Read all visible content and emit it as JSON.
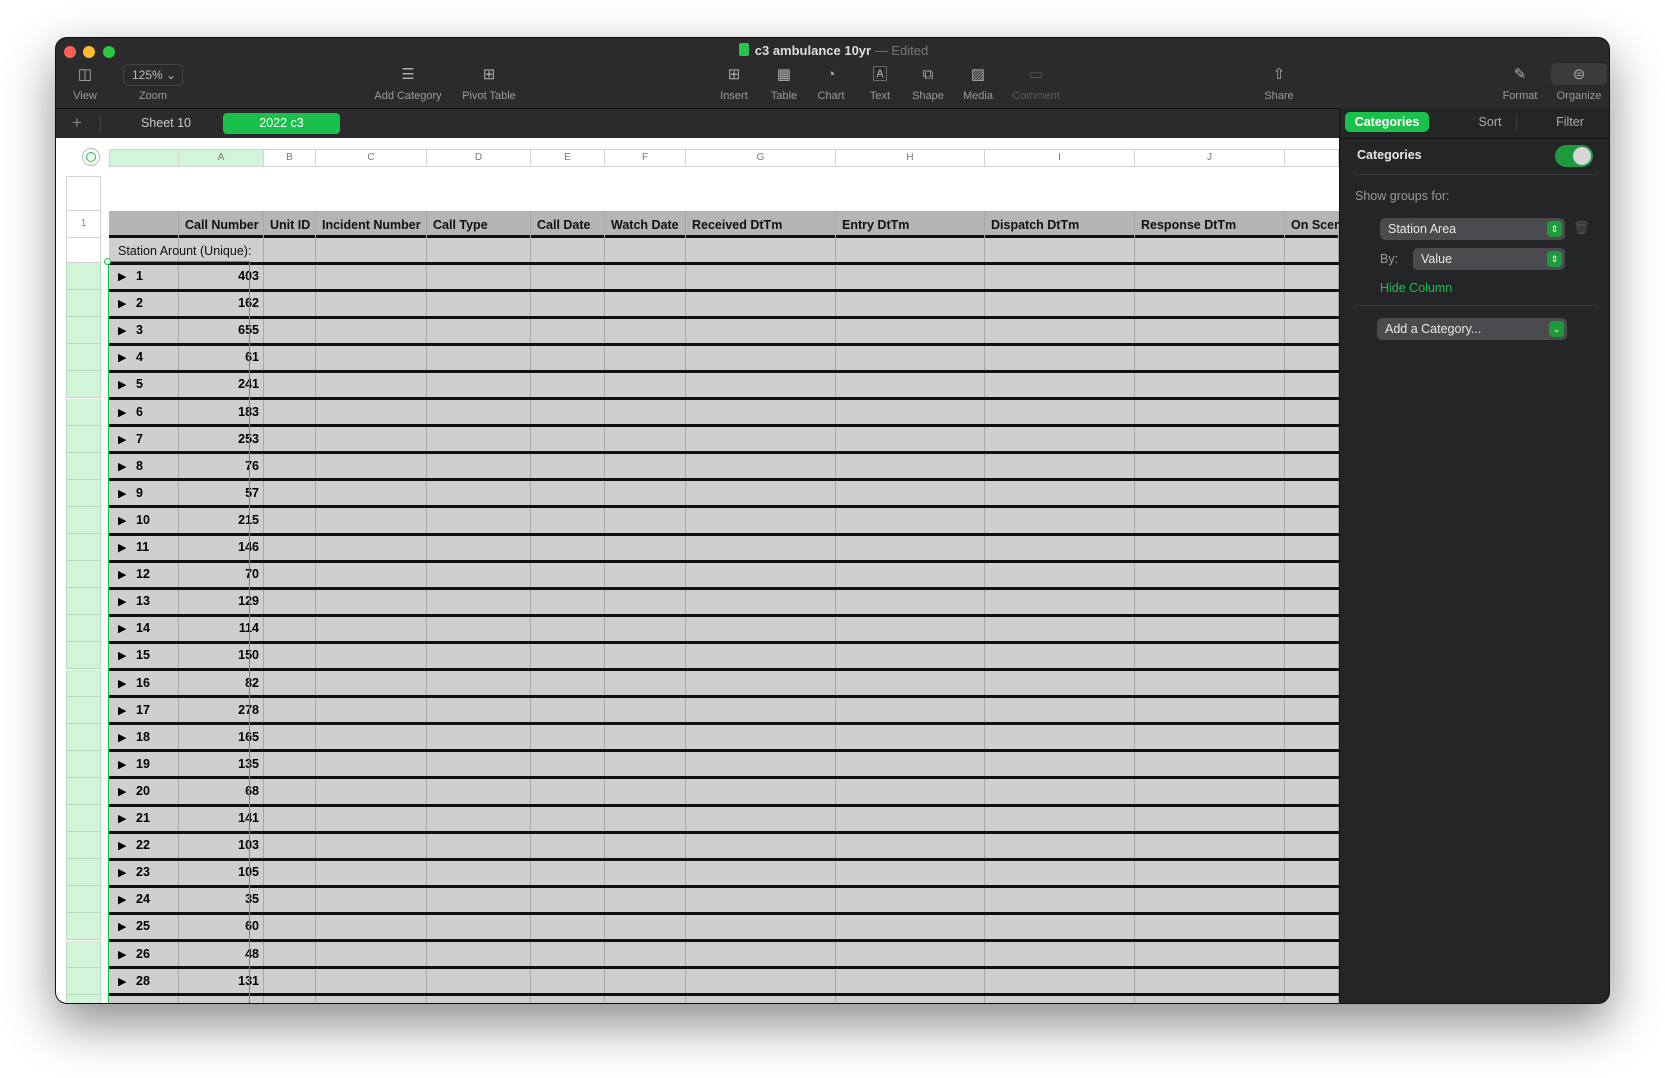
{
  "window": {
    "title": "c3 ambulance 10yr",
    "status": "Edited",
    "separator": "—"
  },
  "toolbar": {
    "view": "View",
    "zoom_label": "Zoom",
    "zoom_value": "125%",
    "add_category": "Add Category",
    "pivot_table": "Pivot Table",
    "insert": "Insert",
    "table": "Table",
    "chart": "Chart",
    "text": "Text",
    "shape": "Shape",
    "media": "Media",
    "comment": "Comment",
    "share": "Share",
    "format": "Format",
    "organize": "Organize"
  },
  "sheets": {
    "add": "+",
    "tabs": [
      "Sheet 10",
      "2022 c3"
    ],
    "active": 1
  },
  "columns": [
    "A",
    "B",
    "C",
    "D",
    "E",
    "F",
    "G",
    "H",
    "I",
    "J",
    ""
  ],
  "row_number": "1",
  "table": {
    "headers": [
      "",
      "Call Number",
      "Unit ID",
      "Incident Number",
      "Call Type",
      "Call Date",
      "Watch Date",
      "Received DtTm",
      "Entry DtTm",
      "Dispatch DtTm",
      "Response DtTm",
      "On Scene"
    ],
    "group_label": "Station Aro​unt (Unique):",
    "groups": [
      {
        "key": "1",
        "value": "403"
      },
      {
        "key": "2",
        "value": "162"
      },
      {
        "key": "3",
        "value": "655"
      },
      {
        "key": "4",
        "value": "61"
      },
      {
        "key": "5",
        "value": "241"
      },
      {
        "key": "6",
        "value": "183"
      },
      {
        "key": "7",
        "value": "253"
      },
      {
        "key": "8",
        "value": "76"
      },
      {
        "key": "9",
        "value": "57"
      },
      {
        "key": "10",
        "value": "215"
      },
      {
        "key": "11",
        "value": "146"
      },
      {
        "key": "12",
        "value": "70"
      },
      {
        "key": "13",
        "value": "129"
      },
      {
        "key": "14",
        "value": "114"
      },
      {
        "key": "15",
        "value": "150"
      },
      {
        "key": "16",
        "value": "82"
      },
      {
        "key": "17",
        "value": "278"
      },
      {
        "key": "18",
        "value": "165"
      },
      {
        "key": "19",
        "value": "135"
      },
      {
        "key": "20",
        "value": "68"
      },
      {
        "key": "21",
        "value": "141"
      },
      {
        "key": "22",
        "value": "103"
      },
      {
        "key": "23",
        "value": "105"
      },
      {
        "key": "24",
        "value": "35"
      },
      {
        "key": "25",
        "value": "60"
      },
      {
        "key": "26",
        "value": "48"
      },
      {
        "key": "28",
        "value": "131"
      }
    ]
  },
  "sidebar": {
    "tabs": [
      "Categories",
      "Sort",
      "Filter"
    ],
    "heading": "Categories",
    "toggle_on": true,
    "show_groups_for": "Show groups for:",
    "group_by_column": "Station Area",
    "by_label": "By:",
    "by_value": "Value",
    "hide_column": "Hide Column",
    "add_category": "Add a Category..."
  },
  "colors": {
    "accent": "#19c14a",
    "header_bg": "#b5b5b5",
    "cell_bg": "#cfcfcf",
    "selection": "#d2f5d9"
  }
}
